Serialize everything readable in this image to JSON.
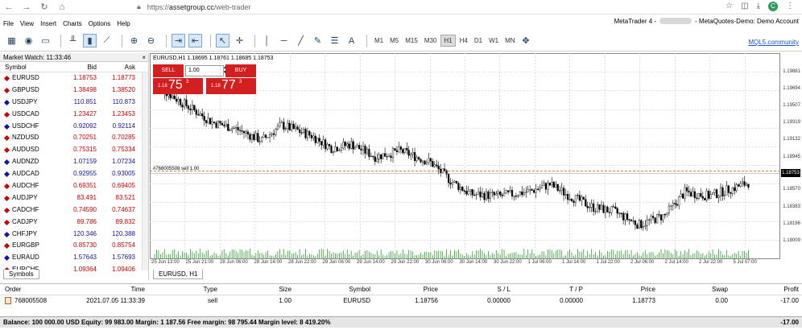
{
  "browser": {
    "url_scheme": "https://",
    "url_host": "assetgroup.cc",
    "url_path": "/web-trader"
  },
  "menu": {
    "items": [
      "File",
      "View",
      "Insert",
      "Charts",
      "Options",
      "Help"
    ],
    "right_app": "MetaTrader 4 - ",
    "right_account": "- MetaQuotes-Demo: Demo Account"
  },
  "toolbar": {
    "timeframes": [
      "M1",
      "M5",
      "M15",
      "M30",
      "H1",
      "H4",
      "D1",
      "W1",
      "MN"
    ],
    "active_timeframe": "H1",
    "mql_link": "MQL5.community"
  },
  "market_watch": {
    "title": "Market Watch: 11:33:46",
    "headers": {
      "symbol": "Symbol",
      "bid": "Bid",
      "ask": "Ask"
    },
    "tab": "Symbols",
    "rows": [
      {
        "symbol": "EURUSD",
        "bid": "1.18753",
        "ask": "1.18773",
        "color": "red"
      },
      {
        "symbol": "GBPUSD",
        "bid": "1.38498",
        "ask": "1.38520",
        "color": "red"
      },
      {
        "symbol": "USDJPY",
        "bid": "110.851",
        "ask": "110.873",
        "color": "blue"
      },
      {
        "symbol": "USDCAD",
        "bid": "1.23427",
        "ask": "1.23453",
        "color": "red"
      },
      {
        "symbol": "USDCHF",
        "bid": "0.92092",
        "ask": "0.92114",
        "color": "blue"
      },
      {
        "symbol": "NZDUSD",
        "bid": "0.70251",
        "ask": "0.70285",
        "color": "red"
      },
      {
        "symbol": "AUDUSD",
        "bid": "0.75315",
        "ask": "0.75334",
        "color": "red"
      },
      {
        "symbol": "AUDNZD",
        "bid": "1.07159",
        "ask": "1.07234",
        "color": "blue"
      },
      {
        "symbol": "AUDCAD",
        "bid": "0.92955",
        "ask": "0.93005",
        "color": "blue"
      },
      {
        "symbol": "AUDCHF",
        "bid": "0.69351",
        "ask": "0.69405",
        "color": "red"
      },
      {
        "symbol": "AUDJPY",
        "bid": "83.491",
        "ask": "83.521",
        "color": "red"
      },
      {
        "symbol": "CADCHF",
        "bid": "0.74590",
        "ask": "0.74637",
        "color": "red"
      },
      {
        "symbol": "CADJPY",
        "bid": "89.786",
        "ask": "89.832",
        "color": "red"
      },
      {
        "symbol": "CHFJPY",
        "bid": "120.346",
        "ask": "120.388",
        "color": "blue"
      },
      {
        "symbol": "EURGBP",
        "bid": "0.85730",
        "ask": "0.85754",
        "color": "red"
      },
      {
        "symbol": "EURAUD",
        "bid": "1.57643",
        "ask": "1.57693",
        "color": "blue"
      },
      {
        "symbol": "EURCHF",
        "bid": "1.09364",
        "ask": "1.09406",
        "color": "red"
      }
    ]
  },
  "chart": {
    "header": "EURUSD,H1  1.18695 1.18761 1.18685 1.18753",
    "tab": "EURUSD, H1",
    "sell_label": "SELL",
    "buy_label": "BUY",
    "lot": "1.00",
    "sell_price": {
      "prefix": "1.18",
      "big": "75",
      "sup": "3"
    },
    "buy_price": {
      "prefix": "1.18",
      "big": "77",
      "sup": "3"
    },
    "order_label": "#768005508 sell 1.00",
    "current_price": "1.18753",
    "y_ticks": [
      "1.19881",
      "1.19694",
      "1.19507",
      "1.19319",
      "1.19132",
      "1.18945",
      "1.18570",
      "1.18383",
      "1.18196",
      "1.18009"
    ],
    "x_ticks": [
      "25 Jun 13:00",
      "25 Jun 21:00",
      "28 Jun 06:00",
      "28 Jun 14:00",
      "28 Jun 22:00",
      "29 Jun 06:00",
      "29 Jun 14:00",
      "29 Jun 22:00",
      "30 Jun 06:00",
      "30 Jun 14:00",
      "30 Jun 22:00",
      "1 Jul 06:00",
      "1 Jul 14:00",
      "1 Jul 22:00",
      "2 Jul 06:00",
      "2 Jul 14:00",
      "2 Jul 22:00",
      "5 Jul 07:00"
    ],
    "colors": {
      "bull": "#ffffff",
      "bear": "#000000",
      "order_line": "#c86400",
      "volume": "#2ca02c"
    }
  },
  "terminal": {
    "headers": [
      "Order",
      "Time",
      "Type",
      "Size",
      "Symbol",
      "Price",
      "S / L",
      "T / P",
      "Price",
      "Swap",
      "Profit"
    ],
    "row": [
      "768005508",
      "2021.07.05 11:33:39",
      "sell",
      "1.00",
      "EURUSD",
      "1.18756",
      "0.00000",
      "0.00000",
      "1.18773",
      "0.00",
      "-17.00"
    ],
    "balance": "Balance: 100 000.00 USD  Equity: 99 983.00  Margin: 1 187.56  Free margin: 98 795.44  Margin level: 8 419.20%",
    "balance_profit": "-17.00"
  }
}
